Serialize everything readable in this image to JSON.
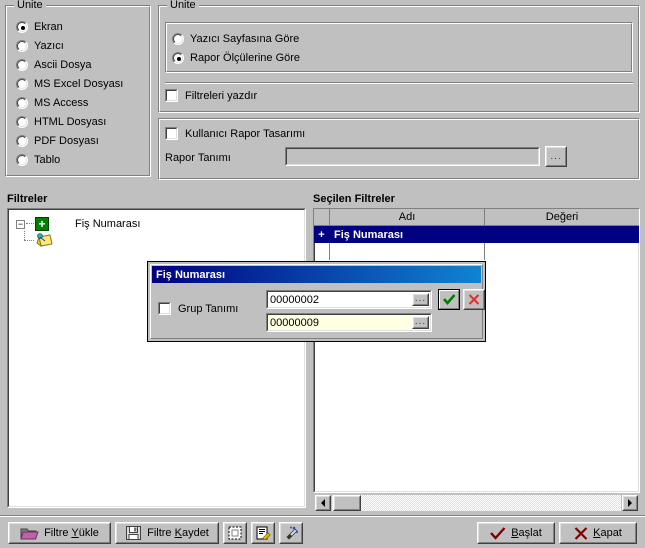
{
  "unit_group": {
    "title": "Ünite",
    "options": [
      {
        "label": "Ekran",
        "selected": true
      },
      {
        "label": "Yazıcı",
        "selected": false
      },
      {
        "label": "Ascii Dosya",
        "selected": false
      },
      {
        "label": "MS Excel Dosyası",
        "selected": false
      },
      {
        "label": "MS Access",
        "selected": false
      },
      {
        "label": "HTML Dosyası",
        "selected": false
      },
      {
        "label": "PDF Dosyası",
        "selected": false
      },
      {
        "label": "Tablo",
        "selected": false
      }
    ]
  },
  "page_group": {
    "title": "Ünite",
    "options": [
      {
        "label": "Yazıcı Sayfasına Göre",
        "selected": false
      },
      {
        "label": "Rapor Ölçülerine Göre",
        "selected": true
      }
    ],
    "print_filters": {
      "label": "Filtreleri yazdır",
      "checked": false
    }
  },
  "design_group": {
    "user_report_design": {
      "label": "Kullanıcı Rapor Tasarımı",
      "checked": false
    },
    "report_definition_label": "Rapor Tanımı",
    "report_definition_value": "",
    "browse_button": "..."
  },
  "filters_panel": {
    "heading": "Filtreler",
    "tree": [
      {
        "label": "Fiş Numarası",
        "expander": "-",
        "icon": "plus-node-icon"
      },
      {
        "label": "",
        "icon": "note-pin-icon"
      }
    ]
  },
  "selected_filters_panel": {
    "heading": "Seçilen Filtreler",
    "columns": [
      "",
      "Adı",
      "Değeri"
    ],
    "rows": [
      {
        "indicator": "+",
        "name": "Fiş Numarası",
        "value": "",
        "selected": true
      }
    ],
    "scrollbar": {
      "left_arrow": "◄",
      "right_arrow": "►"
    }
  },
  "modal": {
    "title": "Fiş Numarası",
    "group_definition": {
      "label": "Grup Tanımı",
      "checked": false
    },
    "value_start": "00000002",
    "value_end": "00000009",
    "ellipsis": "...",
    "ok_icon": "check-icon",
    "cancel_icon": "close-icon"
  },
  "toolbar": {
    "load_filter": {
      "label_pre": "Filtre ",
      "accel": "Y",
      "label_post": "ükle",
      "icon": "folder-open-icon"
    },
    "save_filter": {
      "label_pre": "Filtre ",
      "accel": "K",
      "label_post": "aydet",
      "icon": "floppy-disk-icon"
    },
    "icon_buttons": [
      {
        "name": "clear-selection-icon"
      },
      {
        "name": "edit-document-icon"
      },
      {
        "name": "magic-wand-icon"
      }
    ],
    "start": {
      "label_pre": "",
      "accel": "B",
      "label_post": "aşlat",
      "icon": "check-icon"
    },
    "close": {
      "label_pre": "",
      "accel": "K",
      "label_post": "apat",
      "icon": "cross-icon"
    }
  },
  "colors": {
    "face": "#c0c0c0",
    "selection": "#000080",
    "title_gradient_start": "#000080",
    "title_gradient_end": "#1084d0",
    "field_highlight": "#ffffe1",
    "accent_red": "#800000",
    "accent_green": "#008000"
  }
}
